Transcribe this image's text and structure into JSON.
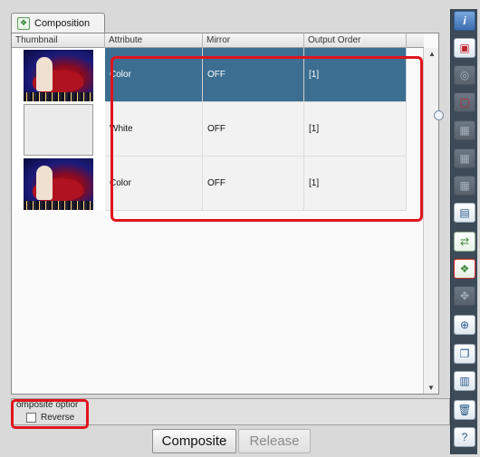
{
  "tab": {
    "label": "Composition",
    "icon": "composition-icon"
  },
  "table": {
    "columns": [
      "Thumbnail",
      "Attribute",
      "Mirror",
      "Output Order"
    ],
    "rows": [
      {
        "thumbnail": "color-image",
        "attribute": "Color",
        "mirror": "OFF",
        "output_order": "[1]",
        "selected": true
      },
      {
        "thumbnail": "white-image",
        "attribute": "White",
        "mirror": "OFF",
        "output_order": "[1]",
        "selected": false
      },
      {
        "thumbnail": "color-image",
        "attribute": "Color",
        "mirror": "OFF",
        "output_order": "[1]",
        "selected": false
      }
    ]
  },
  "composite_options": {
    "title": "omposite optior",
    "reverse_label": "Reverse",
    "reverse_checked": false
  },
  "buttons": {
    "composite": "Composite",
    "release": "Release"
  },
  "colors": {
    "selected_row": "#3b6e91",
    "highlight": "#e0141e",
    "toolbar": "#3d4a57"
  },
  "toolbar_icons": [
    "help-icon",
    "add-layer-icon",
    "disabled-icon",
    "red-frame-icon",
    "stack-icon",
    "stack-alt-icon",
    "stack-alt2-icon",
    "image-list-icon",
    "swap-icon",
    "composition-icon",
    "move-icon",
    "rotate-icon",
    "copy-icon",
    "layout-icon",
    "trash-icon",
    "help-cursor-icon"
  ]
}
